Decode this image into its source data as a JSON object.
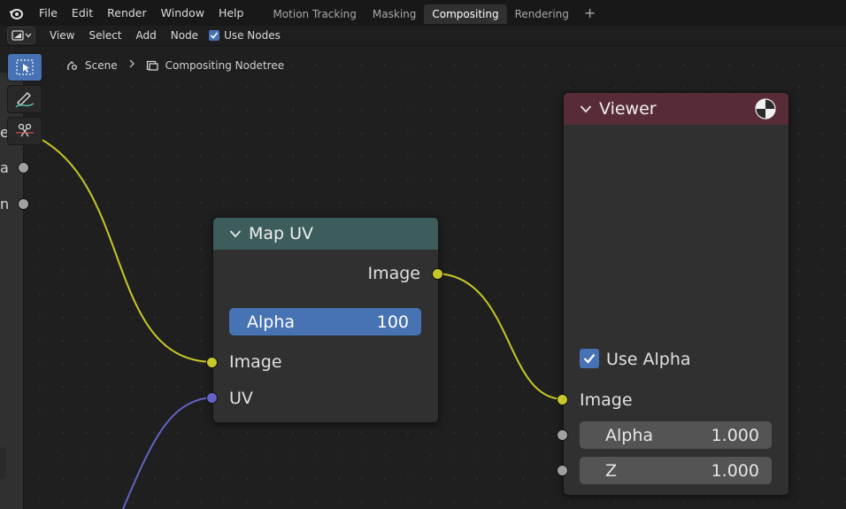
{
  "menubar": {
    "items": [
      "File",
      "Edit",
      "Render",
      "Window",
      "Help"
    ],
    "workspaces": [
      "Motion Tracking",
      "Masking",
      "Compositing",
      "Rendering"
    ],
    "active_workspace": "Compositing",
    "add_label": "+"
  },
  "header": {
    "menus": [
      "View",
      "Select",
      "Add",
      "Node"
    ],
    "use_nodes_label": "Use Nodes",
    "use_nodes_checked": true
  },
  "breadcrumb": {
    "scene": "Scene",
    "nodetree": "Compositing Nodetree"
  },
  "left_node": {
    "visible_fragments": [
      "e",
      "a",
      "n"
    ]
  },
  "map_uv": {
    "title": "Map UV",
    "output_image": "Image",
    "alpha_label": "Alpha",
    "alpha_value": "100",
    "input_image": "Image",
    "input_uv": "UV",
    "header_color": "#3d5c5c"
  },
  "viewer": {
    "title": "Viewer",
    "use_alpha_label": "Use Alpha",
    "use_alpha_checked": true,
    "input_image": "Image",
    "alpha_label": "Alpha",
    "alpha_value": "1.000",
    "z_label": "Z",
    "z_value": "1.000",
    "header_color": "#582c36"
  },
  "colors": {
    "accent": "#4772b3",
    "socket_image": "#c7c729",
    "socket_vector": "#6363c7",
    "socket_value": "#a1a1a1"
  }
}
